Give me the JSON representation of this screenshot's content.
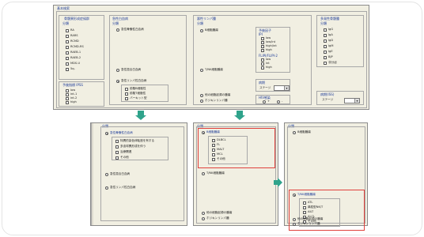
{
  "top": {
    "title": "基本検索",
    "groups": [
      {
        "title": "骨髄異形成症候群",
        "sub": "分類",
        "items": [
          "RA",
          "RARS",
          "RCMD",
          "RCMD-RS",
          "RAEB-1",
          "RAEB-2",
          "MDS-U",
          "5q-"
        ]
      },
      {
        "title": "急性白血病",
        "sub": "分類",
        "items": [
          "急性骨髄性白血病",
          "急性混合白血病",
          "急性リンパ性白血病"
        ],
        "subitems": [
          "前駆B細胞性",
          "前駆T細胞性",
          "バーキット型"
        ]
      },
      {
        "title": "悪性リンパ腫",
        "sub": "分類",
        "items": [
          "B細胞腫瘍",
          "T/NK細胞腫瘍",
          "他の細胞起源の腫瘍",
          "ホジキンリンパ腫"
        ]
      },
      {
        "title": "予後因子",
        "sub": "IPI",
        "items": [
          "low",
          "low/int",
          "high/int",
          "high"
        ],
        "sub2": "FLIPI/FLIPI-2",
        "items2": [
          "low",
          "int",
          "high"
        ]
      },
      {
        "title": "多発性骨髄腫",
        "sub": "分類",
        "items": [
          "IgG",
          "IgA",
          "IgD",
          "IgM",
          "IgE",
          "BJP",
          "非分泌"
        ]
      }
    ],
    "prognosis": {
      "title": "予後指標 IPSS",
      "items": [
        "low",
        "int-1",
        "int-2",
        "high"
      ]
    },
    "stage": {
      "title": "病期",
      "label": "ステージ",
      "value": ""
    },
    "hiv": {
      "title": "HIV感染",
      "options": [
        "+",
        "-"
      ]
    },
    "stage2": {
      "title": "病期(ISS)",
      "label": "ステージ",
      "value": ""
    }
  },
  "panel1": {
    "sub": "分類",
    "main": "急性骨髄性白血病",
    "items": [
      "特異的染色体転座を有する",
      "多血球異形成を伴う",
      "治療関連",
      "その他"
    ],
    "rest": [
      "急性混合白血病",
      "急性リンパ性白血病"
    ]
  },
  "panel2": {
    "sub": "分類",
    "main": "B細胞腫瘍",
    "items": [
      "DLBCL",
      "FL",
      "MALT",
      "MCL",
      "その他"
    ],
    "rest": [
      "T/NK細胞腫瘍",
      "他の細胞起源の腫瘍",
      "ホジキンリンパ腫"
    ]
  },
  "panel3": {
    "sub": "分類",
    "top": "B細胞腫瘍",
    "main": "T/NK細胞腫瘍",
    "items": [
      "ATL",
      "鼻腔型NK/T",
      "AILT",
      "ALCL",
      "その他"
    ],
    "rest": [
      "他の細胞起源の腫瘍",
      "ホジキンリンパ腫"
    ]
  },
  "colors": {
    "accent": "#2fa38b",
    "highlight": "#e0413c",
    "title": "#1f3d99",
    "window": "#f1efe2"
  }
}
